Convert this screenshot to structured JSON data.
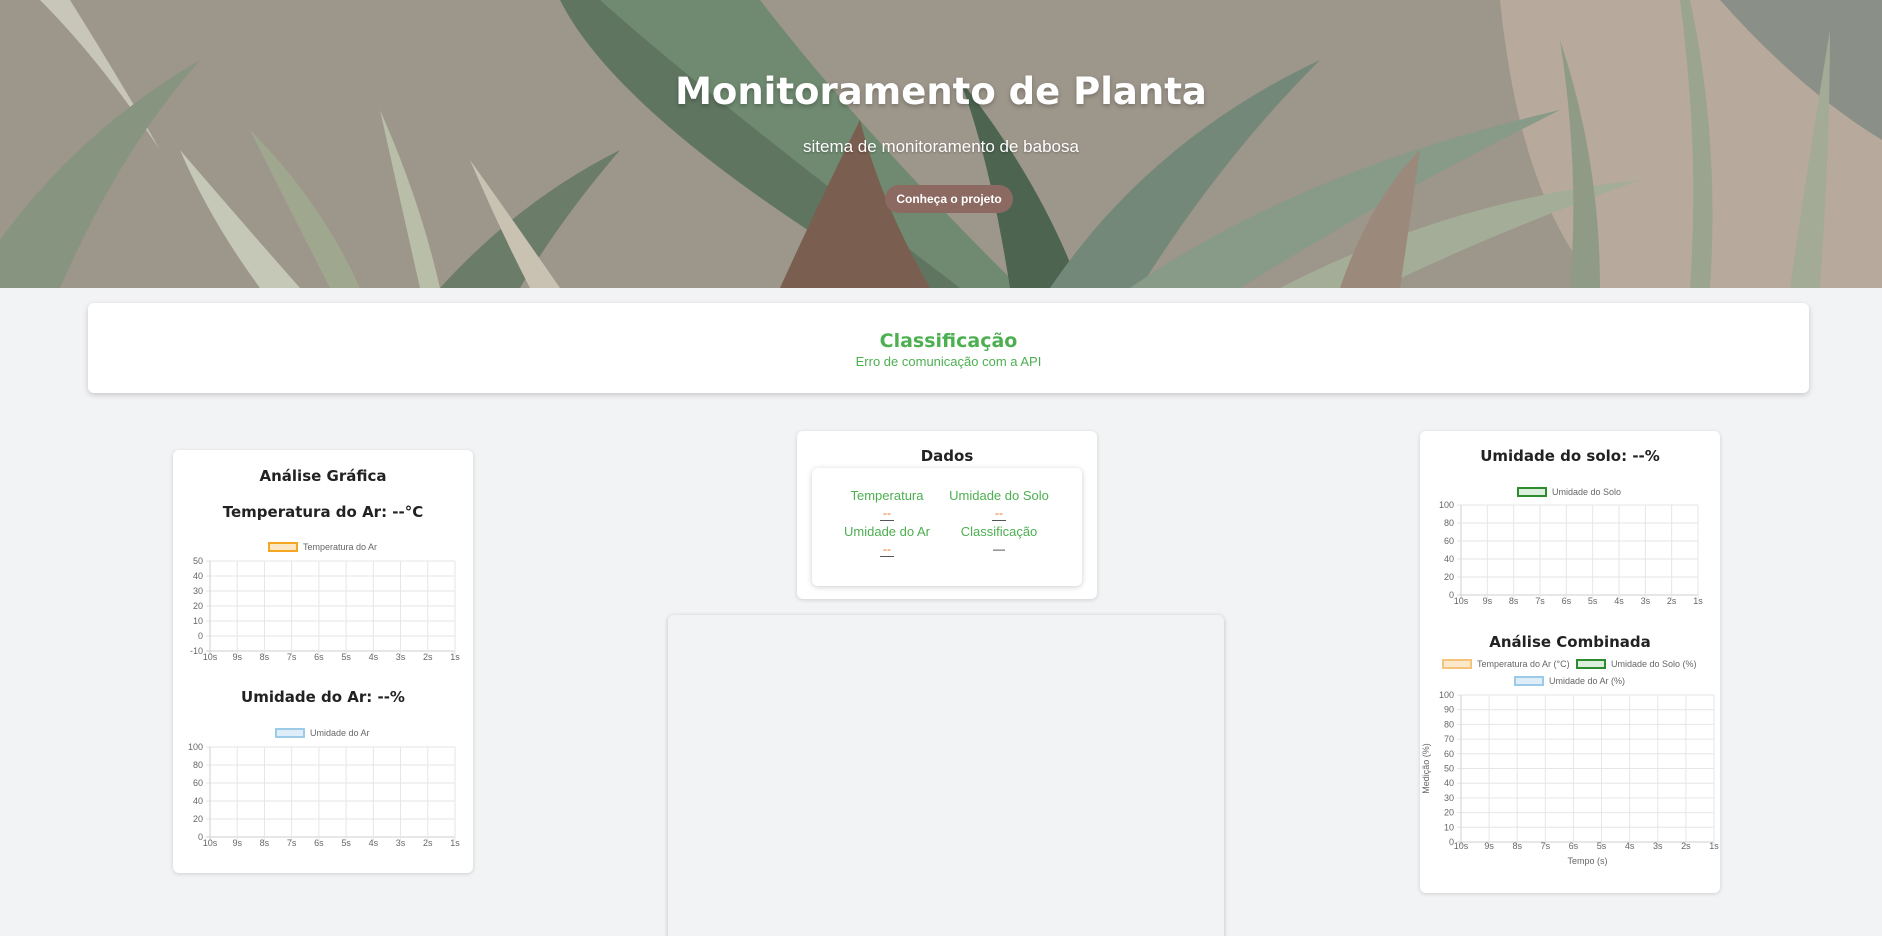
{
  "hero": {
    "title": "Monitoramento de Planta",
    "subtitle": "sitema de monitoramento de babosa",
    "button_label": "Conheça o projeto"
  },
  "classification": {
    "title": "Classificação",
    "message": "Erro de comunicação com a API"
  },
  "analysis": {
    "title": "Análise Gráfica",
    "temp_heading": "Temperatura do Ar: --°C",
    "humid_heading": "Umidade do Ar: --%"
  },
  "dados": {
    "title": "Dados",
    "temp_label": "Temperatura",
    "temp_value": "--",
    "soil_label": "Umidade do Solo",
    "soil_value": "--",
    "air_label": "Umidade do Ar",
    "air_value": "--",
    "class_label": "Classificação",
    "class_value": "—"
  },
  "soil_card": {
    "heading": "Umidade do solo: --%",
    "combined_heading": "Análise Combinada"
  },
  "colors": {
    "accent_green": "#4caf50",
    "button_brown": "#8c6a62",
    "temp_orange": "#f5a623",
    "air_blue": "#9ccbe8",
    "soil_green": "#2e8b2e"
  },
  "chart_data": [
    {
      "type": "line",
      "x": [
        "10s",
        "9s",
        "8s",
        "7s",
        "6s",
        "5s",
        "4s",
        "3s",
        "2s",
        "1s"
      ],
      "series": [
        {
          "name": "Temperatura do Ar",
          "values": [],
          "color": "#f5a623"
        }
      ],
      "yticks": [
        "50",
        "40",
        "30",
        "20",
        "10",
        "0",
        "-10"
      ],
      "ylim": [
        -10,
        50
      ],
      "grid": true,
      "legend": "top"
    },
    {
      "type": "line",
      "x": [
        "10s",
        "9s",
        "8s",
        "7s",
        "6s",
        "5s",
        "4s",
        "3s",
        "2s",
        "1s"
      ],
      "series": [
        {
          "name": "Umidade do Ar",
          "values": [],
          "color": "#9ccbe8"
        }
      ],
      "yticks": [
        "100",
        "80",
        "60",
        "40",
        "20",
        "0"
      ],
      "ylim": [
        0,
        100
      ],
      "grid": true,
      "legend": "top"
    },
    {
      "type": "line",
      "x": [
        "10s",
        "9s",
        "8s",
        "7s",
        "6s",
        "5s",
        "4s",
        "3s",
        "2s",
        "1s"
      ],
      "series": [
        {
          "name": "Umidade do Solo",
          "values": [],
          "color": "#2e8b2e"
        }
      ],
      "yticks": [
        "100",
        "80",
        "60",
        "40",
        "20",
        "0"
      ],
      "ylim": [
        0,
        100
      ],
      "grid": true,
      "legend": "top"
    },
    {
      "type": "line",
      "x": [
        "10s",
        "9s",
        "8s",
        "7s",
        "6s",
        "5s",
        "4s",
        "3s",
        "2s",
        "1s"
      ],
      "series": [
        {
          "name": "Temperatura do Ar (°C)",
          "values": [],
          "color": "#f5a623"
        },
        {
          "name": "Umidade do Solo (%)",
          "values": [],
          "color": "#2e8b2e"
        },
        {
          "name": "Umidade do Ar (%)",
          "values": [],
          "color": "#9ccbe8"
        }
      ],
      "yticks": [
        "100",
        "90",
        "80",
        "70",
        "60",
        "50",
        "40",
        "30",
        "20",
        "10",
        "0"
      ],
      "ylim": [
        0,
        100
      ],
      "xlabel": "Tempo (s)",
      "ylabel": "Medição (%)",
      "grid": true,
      "legend": "top"
    }
  ]
}
